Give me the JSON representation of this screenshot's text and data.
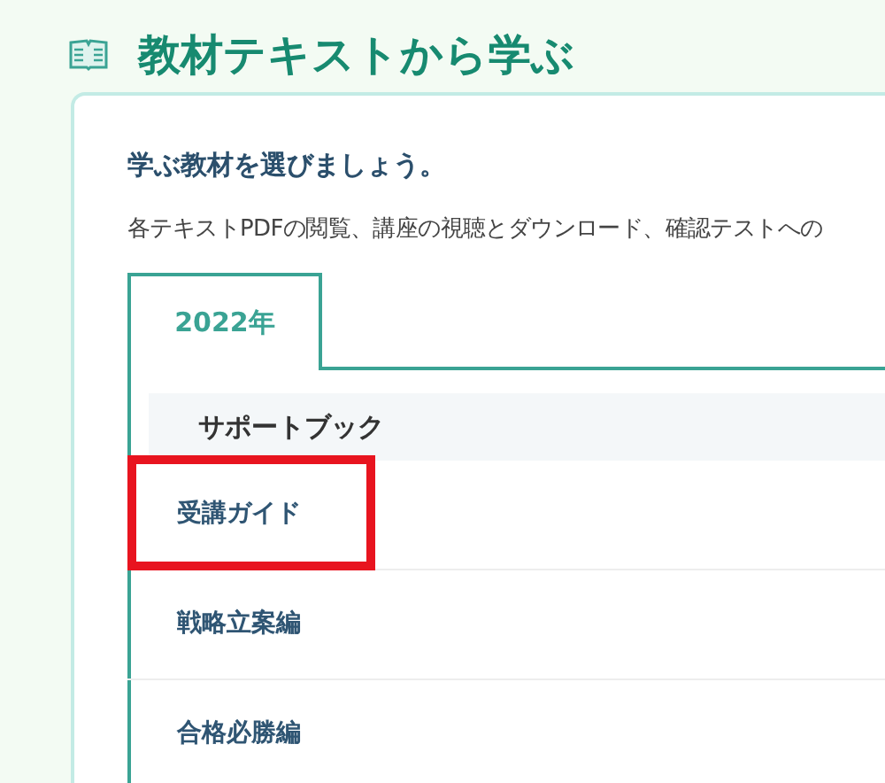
{
  "page_title": "教材テキストから学ぶ",
  "card": {
    "heading": "学ぶ教材を選びましょう。",
    "description": "各テキストPDFの閲覧、講座の視聴とダウンロード、確認テストへの"
  },
  "tabs": [
    {
      "label": "2022年",
      "selected": true
    }
  ],
  "sections": [
    {
      "title": "サポートブック",
      "items": [
        {
          "label": "受講ガイド",
          "highlighted": true
        },
        {
          "label": "戦略立案編",
          "highlighted": false
        },
        {
          "label": "合格必勝編",
          "highlighted": false
        }
      ]
    }
  ]
}
